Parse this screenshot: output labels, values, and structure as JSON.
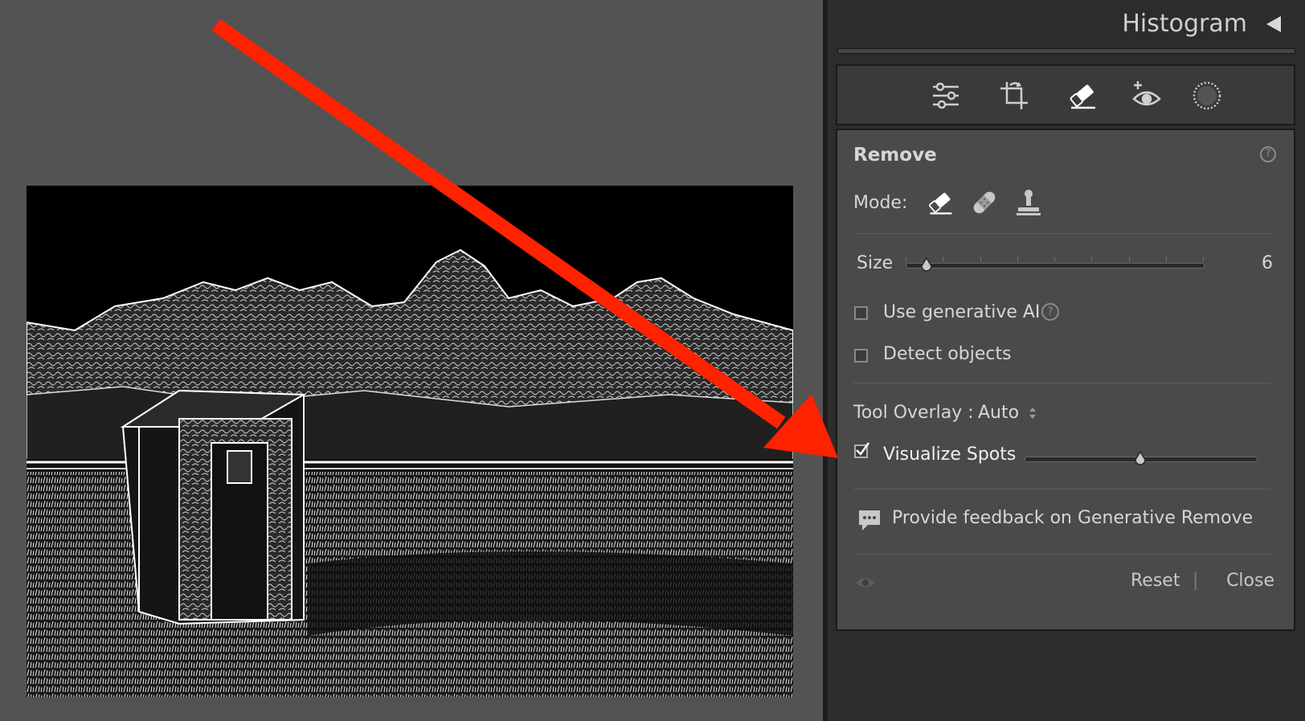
{
  "panel": {
    "histogram_title": "Histogram",
    "remove": {
      "title": "Remove",
      "mode_label": "Mode:",
      "size_label": "Size",
      "size_value": "6",
      "size_level": 0.07,
      "use_generative_ai": {
        "label": "Use generative AI",
        "checked": false
      },
      "detect_objects": {
        "label": "Detect objects",
        "checked": false
      },
      "tool_overlay_label": "Tool Overlay :",
      "tool_overlay_value": "Auto",
      "visualize_spots": {
        "label": "Visualize Spots",
        "checked": true,
        "level": 0.5
      },
      "feedback_label": "Provide feedback on Generative Remove",
      "reset_label": "Reset",
      "close_label": "Close",
      "separator": "|"
    }
  },
  "icons": {
    "tools": [
      "sliders-icon",
      "crop-icon",
      "eraser-icon",
      "redeye-icon",
      "mask-icon"
    ],
    "modes": [
      "eraser-icon",
      "bandage-icon",
      "stamp-icon"
    ]
  },
  "colors": {
    "annotation_arrow": "#ff2200",
    "panel_bg": "#4a4a4a",
    "canvas_bg": "#535353"
  }
}
